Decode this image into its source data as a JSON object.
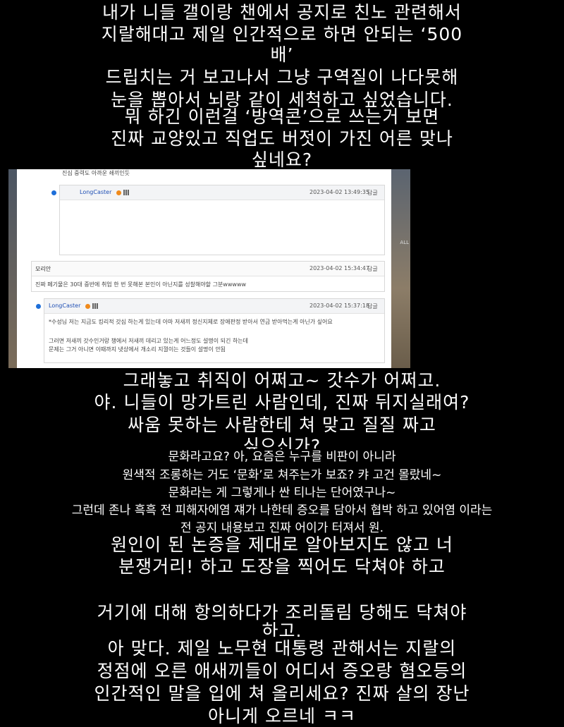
{
  "top_caption": {
    "lines": [
      "내가 니들 갤이랑 챈에서 공지로 친노 관련해서",
      "지랄해대고 제일 인간적으로 하면 안되는 ‘500",
      "배’",
      "드립치는 거 보고나서 그냥 구역질이 나다못해",
      "눈을 뽑아서 뇌랑 같이 세척하고 싶었습니다.",
      "뭐 하긴 이런걸 ‘방역콘’으로 쓰는거 보면",
      "진짜 교양있고 직업도 버젓이 가진 어른 맞나",
      "싶네요?"
    ]
  },
  "screenshot": {
    "top_fragment": "진심 중력도 아까운 쇄끼인듯",
    "side_label": "ALL",
    "comments": [
      {
        "author": "LongCaster",
        "timestamp": "2023-04-02 13:49:35",
        "reply_label": "답글",
        "body": []
      },
      {
        "author": "모리안",
        "timestamp": "2023-04-02 15:34:47",
        "reply_label": "답글",
        "body": [
          "진짜 페기물은 30대 중반에 취업 한 번 못해본 본인이 아닌지를 성찰해야할 그분wwwww"
        ]
      },
      {
        "author": "LongCaster",
        "timestamp": "2023-04-02 15:37:18",
        "reply_label": "답글",
        "body": [
          "*수성님 저는 지금도 킹리적 갓심 하는게 있는데 아마 저새끼 정신지체로 장애판정 받아서 연금 받아먹는게 아닌가 싶어요",
          "",
          "그러면 저새끼 갓수인거랑 챙에서 저새끼 데리고 있는게 어느정도 설명이 되긴 하는데",
          "문제는 그거 아니면 이때까지 냇상에서 개소리 지껄이는 것들이 설명이 안됨"
        ]
      }
    ]
  },
  "middle_caption": {
    "lines": [
      "그래놓고 취직이 어쩌고~ 갓수가 어쩌고.",
      "야. 니들이 망가트린 사람인데, 진짜 뒤지실래여?",
      "싸움 못하는 사람한테 쳐 맞고 질질 짜고",
      "싶으신가?"
    ]
  },
  "small_caption": {
    "lines": [
      "문화라고요? 아, 요즘은 누구를 비판이 아니라",
      "원색적 조롱하는 거도 ‘문화’로 쳐주는가 보죠? 캬 고건 몰랐네~",
      "문화라는 게 그렇게나 싼 티나는 단어였구나~",
      "그런데 존나 흑흑 전 피해자에염 쟤가 나한테 증오를 담아서 협박 하고 있어염 이라는",
      "전 공지 내용보고 진짜 어이가 터져서 원."
    ]
  },
  "bottom_caption": {
    "lines": [
      "원인이 된 논증을 제대로 알아보지도 않고 너",
      "분쟁거리! 하고 도장을 찍어도 닥쳐야 하고",
      "",
      "거기에 대해 항의하다가 조리돌림 당해도 닥쳐야",
      "하고.",
      "아 맞다. 제일 노무현 대통령 관해서는 지랄의",
      "정점에 오른 애새끼들이 어디서 증오랑 혐오등의",
      "인간적인 말을 입에 쳐 올리세요? 진짜 살의 장난",
      "아니게 오르네 ㅋㅋ"
    ]
  }
}
